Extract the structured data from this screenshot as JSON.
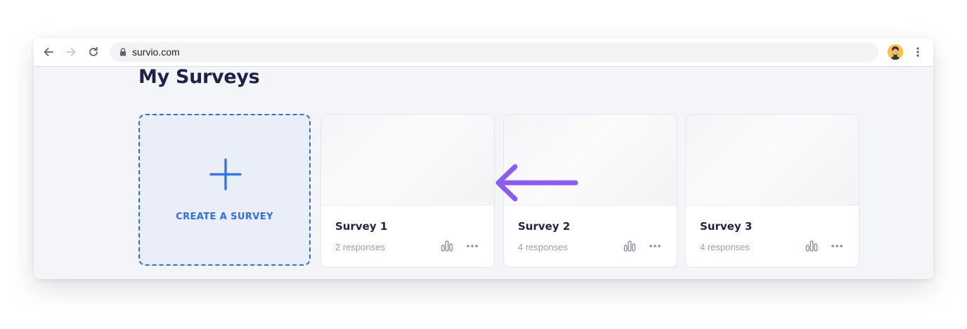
{
  "browser": {
    "url": "survio.com",
    "icons": [
      "back-icon",
      "forward-icon",
      "reload-icon",
      "lock-icon",
      "avatar",
      "kebab-menu-icon"
    ]
  },
  "page": {
    "title": "My Surveys",
    "create_card": {
      "label": "CREATE A SURVEY",
      "icon": "plus-icon"
    },
    "surveys": [
      {
        "title": "Survey 1",
        "responses": "2 responses"
      },
      {
        "title": "Survey 2",
        "responses": "4 responses"
      },
      {
        "title": "Survey 3",
        "responses": "4 responses"
      }
    ]
  },
  "annotation": {
    "icon": "arrow-left-icon",
    "color": "#8a5cf6"
  },
  "colors": {
    "accent": "#2b6ef2",
    "title": "#1f2148",
    "muted_text": "#9a9db0",
    "page_bg": "#f4f5f8"
  }
}
